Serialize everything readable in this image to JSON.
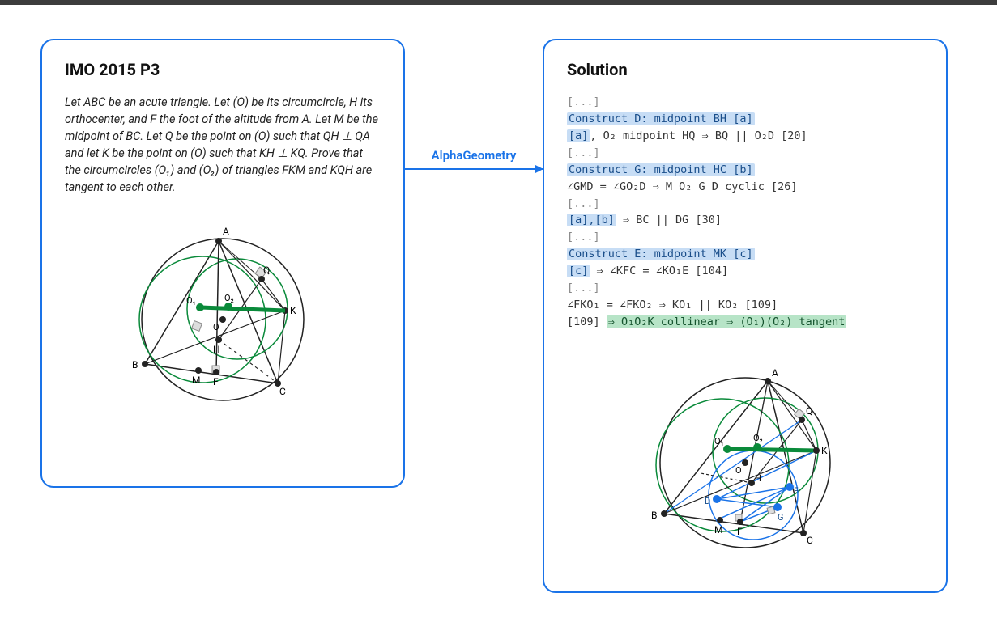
{
  "arrow_label": "AlphaGeometry",
  "left": {
    "title": "IMO 2015 P3",
    "problem": "Let ABC be an acute triangle. Let (O) be its circumcircle, H its orthocenter, and F the foot of the altitude from A. Let M be the midpoint of BC. Let Q be the point on (O) such that QH ⊥ QA and let K be the point on (O) such that KH ⊥ KQ. Prove that the circumcircles (O₁) and (O₂) of triangles FKM and KQH are tangent to each other.",
    "diagram_labels": {
      "A": "A",
      "B": "B",
      "C": "C",
      "M": "M",
      "F": "F",
      "H": "H",
      "K": "K",
      "Q": "Q",
      "O1": "O₁",
      "O2": "O₂",
      "O": "O"
    }
  },
  "right": {
    "title": "Solution",
    "lines": {
      "l0": "[...]",
      "l1": "Construct D: midpoint BH [a]",
      "l2a": "[a]",
      "l2b": ", O₂ midpoint HQ ⇒ BQ || O₂D [20]",
      "l3": "[...]",
      "l4": "Construct G: midpoint HC [b]",
      "l5": "∠GMD = ∠GO₂D ⇒ M O₂ G D cyclic [26]",
      "l6": "[...]",
      "l7a": "[a],[b]",
      "l7b": " ⇒ BC || DG [30]",
      "l8": "[...]",
      "l9": "Construct E: midpoint MK [c]",
      "l10a": "[c]",
      "l10b": " ⇒ ∠KFC = ∠KO₁E [104]",
      "l11": "[...]",
      "l12": "∠FKO₁ = ∠FKO₂ ⇒ KO₁ || KO₂ [109]",
      "l13a": "[109] ",
      "l13b": "⇒ O₁O₂K collinear ⇒ (O₁)(O₂) tangent"
    },
    "diagram_labels": {
      "A": "A",
      "B": "B",
      "C": "C",
      "M": "M",
      "F": "F",
      "H": "H",
      "K": "K",
      "Q": "Q",
      "O1": "O₁",
      "O2": "O₂",
      "O": "O",
      "D": "D",
      "E": "E",
      "G": "G"
    }
  }
}
